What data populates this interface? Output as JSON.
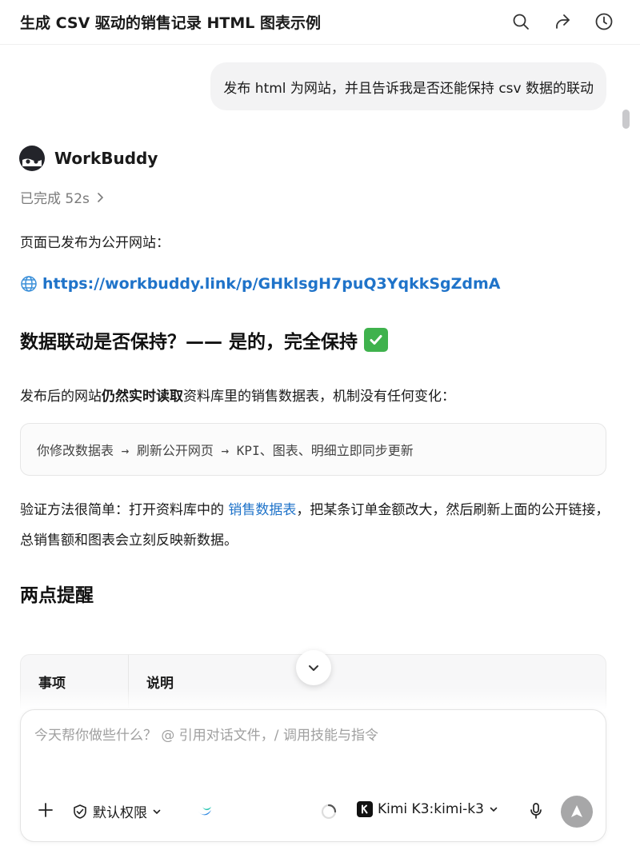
{
  "header": {
    "title": "生成 CSV 驱动的销售记录 HTML 图表示例",
    "icons": [
      "search-icon",
      "share-icon",
      "history-icon"
    ]
  },
  "user_message": "发布 html 为网站，并且告诉我是否还能保持 csv 数据的联动",
  "agent": {
    "name": "WorkBuddy",
    "status": "已完成 52s"
  },
  "content": {
    "p1": "页面已发布为公开网站：",
    "link": "https://workbuddy.link/p/GHklsgH7puQ3YqkkSgZdmA",
    "h2": "数据联动是否保持？—— 是的，完全保持",
    "p2_pre": "发布后的网站",
    "p2_bold": "仍然实时读取",
    "p2_post": "资料库里的销售数据表，机制没有任何变化：",
    "code": "你修改数据表 → 刷新公开网页 → KPI、图表、明细立即同步更新",
    "p3_pre": "验证方法很简单：打开资料库中的 ",
    "p3_link": "销售数据表",
    "p3_post": "，把某条订单金额改大，然后刷新上面的公开链接，总销售额和图表会立刻反映新数据。",
    "h3": "两点提醒",
    "table_headers": [
      "事项",
      "说明"
    ]
  },
  "composer": {
    "placeholder": "今天帮你做些什么？ @ 引用对话文件，/ 调用技能与指令",
    "permission": "默认权限",
    "model": "Kimi K3:kimi-k3"
  },
  "colors": {
    "link": "#1f73c9",
    "check": "#3fb24d",
    "send_disabled": "#a7a7a8"
  }
}
